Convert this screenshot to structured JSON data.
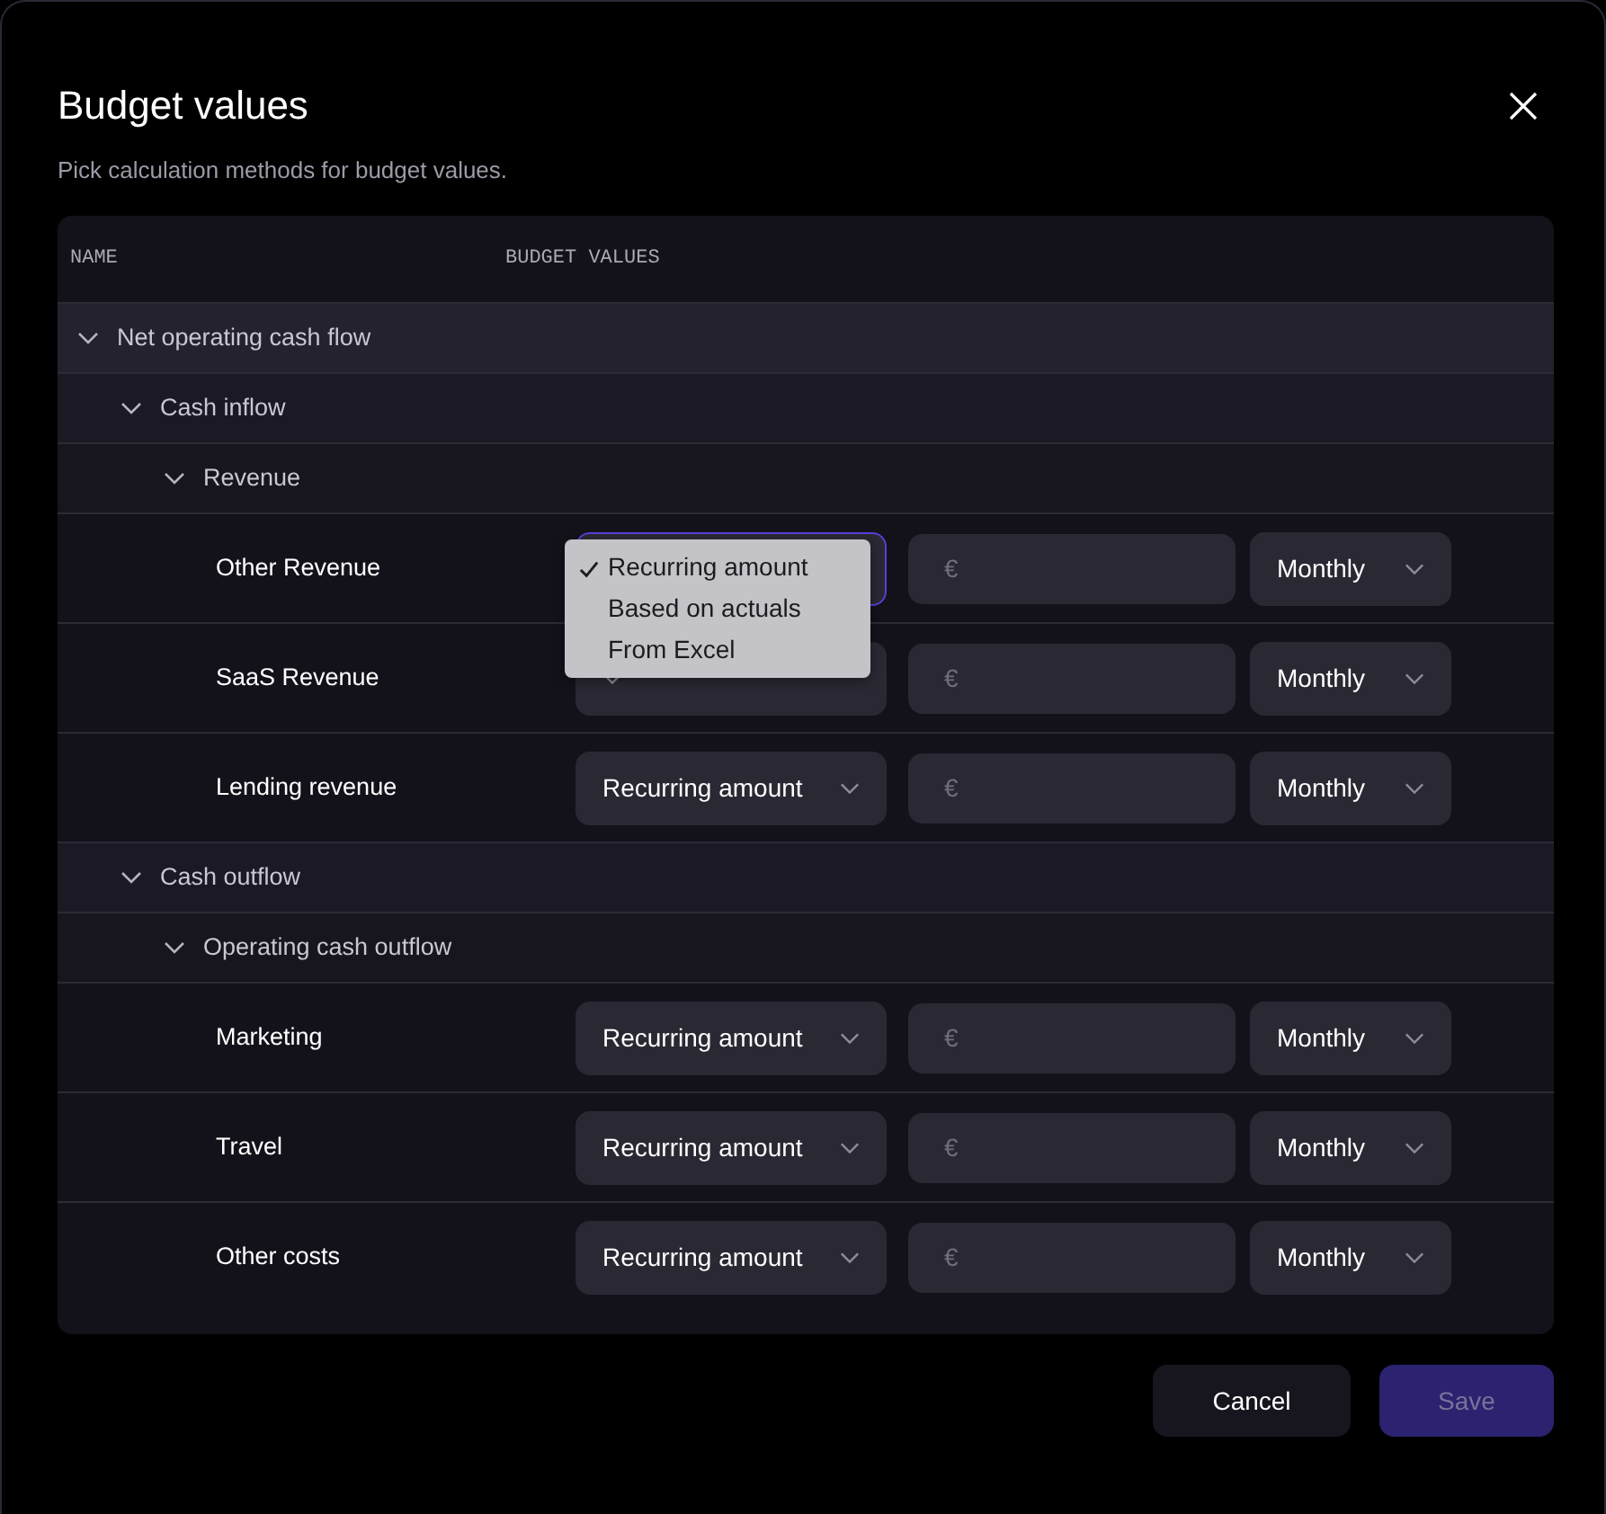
{
  "dialog": {
    "title": "Budget values",
    "subtitle": "Pick calculation methods for budget values."
  },
  "table": {
    "columns": [
      "NAME",
      "BUDGET VALUES"
    ],
    "rows": [
      {
        "name": "Net operating cash flow",
        "expanded": true,
        "children": [
          {
            "name": "Cash inflow",
            "expanded": true,
            "children": [
              {
                "name": "Revenue",
                "expanded": true,
                "children": [
                  {
                    "name": "Other Revenue",
                    "kind": "line",
                    "focused": true,
                    "amount_placeholder": "€",
                    "frequency": "Monthly",
                    "menu": [
                      {
                        "label": "Recurring amount",
                        "selected": true
                      },
                      {
                        "label": "Based on actuals",
                        "selected": false
                      },
                      {
                        "label": "From Excel",
                        "selected": false
                      }
                    ]
                  },
                  {
                    "name": "SaaS Revenue",
                    "kind": "line",
                    "focused": false,
                    "amount_placeholder": "€",
                    "frequency": "Monthly"
                  },
                  {
                    "name": "Lending revenue",
                    "kind": "line",
                    "focused": false,
                    "method": "Recurring amount",
                    "amount_placeholder": "€",
                    "frequency": "Monthly"
                  }
                ]
              }
            ]
          },
          {
            "name": "Cash outflow",
            "expanded": true,
            "children": [
              {
                "name": "Operating cash outflow",
                "expanded": true,
                "children": [
                  {
                    "name": "Marketing",
                    "kind": "line",
                    "focused": false,
                    "method": "Recurring amount",
                    "amount_placeholder": "€",
                    "frequency": "Monthly"
                  },
                  {
                    "name": "Travel",
                    "kind": "line",
                    "focused": false,
                    "method": "Recurring amount",
                    "amount_placeholder": "€",
                    "frequency": "Monthly"
                  },
                  {
                    "name": "Other costs",
                    "kind": "line",
                    "focused": false,
                    "method": "Recurring amount",
                    "amount_placeholder": "€",
                    "frequency": "Monthly"
                  }
                ]
              }
            ]
          }
        ]
      }
    ]
  },
  "buttons": [
    {
      "label": "Cancel",
      "kind": "secondary",
      "disabled": false
    },
    {
      "label": "Save",
      "kind": "primary",
      "disabled": true
    }
  ]
}
